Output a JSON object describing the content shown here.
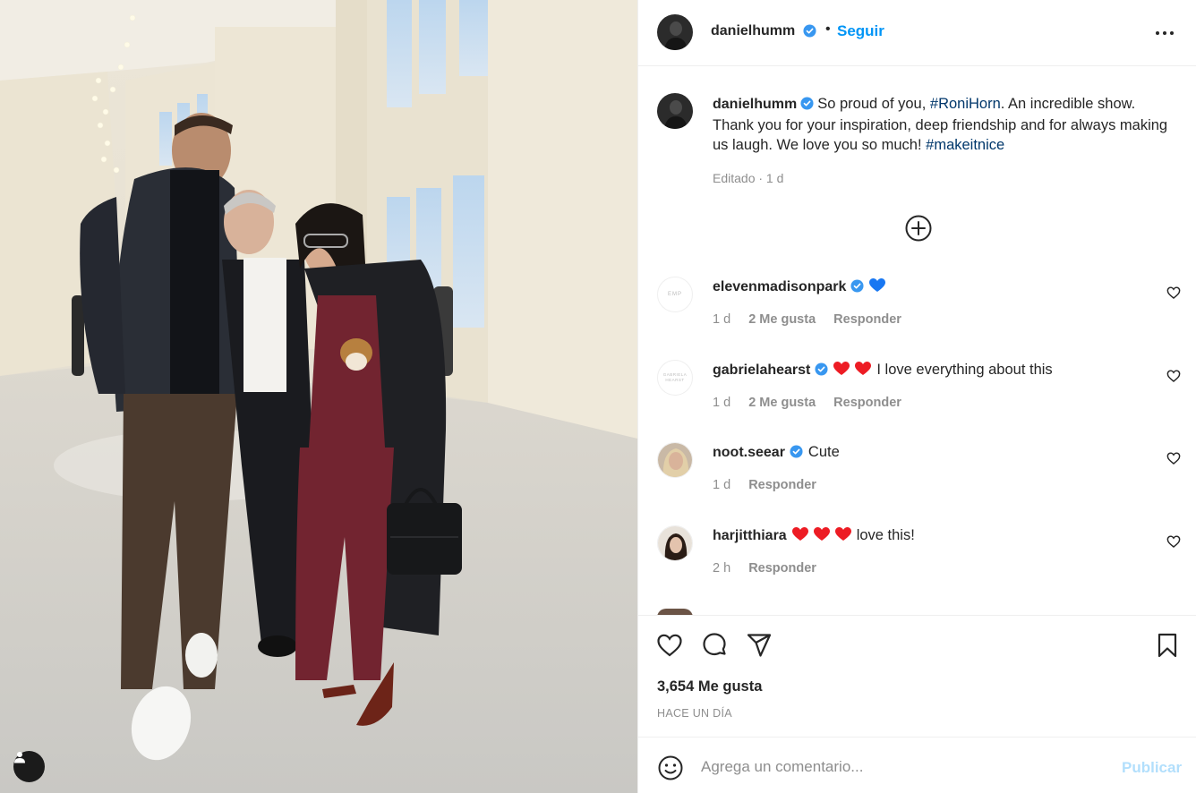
{
  "post": {
    "author": "danielhumm",
    "follow_label": "Seguir",
    "separator": "•",
    "caption_text_1": "So proud of you, ",
    "caption_tag_1": "#RoniHorn",
    "caption_text_2": ". An incredible show. Thank you for your inspiration, deep friendship and for always making us laugh. We love you so much! ",
    "caption_tag_2": "#makeitnice",
    "edited": "Editado · 1 d",
    "likes": "3,654 Me gusta",
    "time_ago": "HACE UN DÍA"
  },
  "comments": [
    {
      "username": "elevenmadisonpark",
      "verified": true,
      "hearts": 1,
      "heart_color": "#1877f2",
      "text": "",
      "time": "1 d",
      "likes": "2 Me gusta",
      "reply": "Responder",
      "avatar_text": "EMP"
    },
    {
      "username": "gabrielahearst",
      "verified": true,
      "hearts": 2,
      "heart_color": "#ed1c24",
      "text": "I love everything about this",
      "time": "1 d",
      "likes": "2 Me gusta",
      "reply": "Responder",
      "avatar_text": "GABRIELA HEARST"
    },
    {
      "username": "noot.seear",
      "verified": true,
      "hearts": 0,
      "heart_color": "#ed1c24",
      "text": "Cute",
      "time": "1 d",
      "likes": "",
      "reply": "Responder",
      "avatar_text": ""
    },
    {
      "username": "harjitthiara",
      "verified": false,
      "hearts": 3,
      "heart_color": "#ed1c24",
      "text": "love this!",
      "time": "2 h",
      "likes": "",
      "reply": "Responder",
      "avatar_text": ""
    }
  ],
  "add_comment": {
    "placeholder": "Agrega un comentario...",
    "publish_label": "Publicar"
  },
  "colors": {
    "link_blue": "#0095f6",
    "hashtag": "#00376b",
    "muted": "#8e8e8e",
    "verified": "#3897f0",
    "publish_disabled": "#b2dffc"
  },
  "icons": {
    "more": "more-horizontal-icon",
    "load_more": "plus-circle-icon",
    "like": "heart-icon",
    "comment": "comment-bubble-icon",
    "share": "paper-plane-icon",
    "save": "bookmark-icon",
    "emoji": "smiley-icon",
    "tag": "user-tag-icon"
  }
}
